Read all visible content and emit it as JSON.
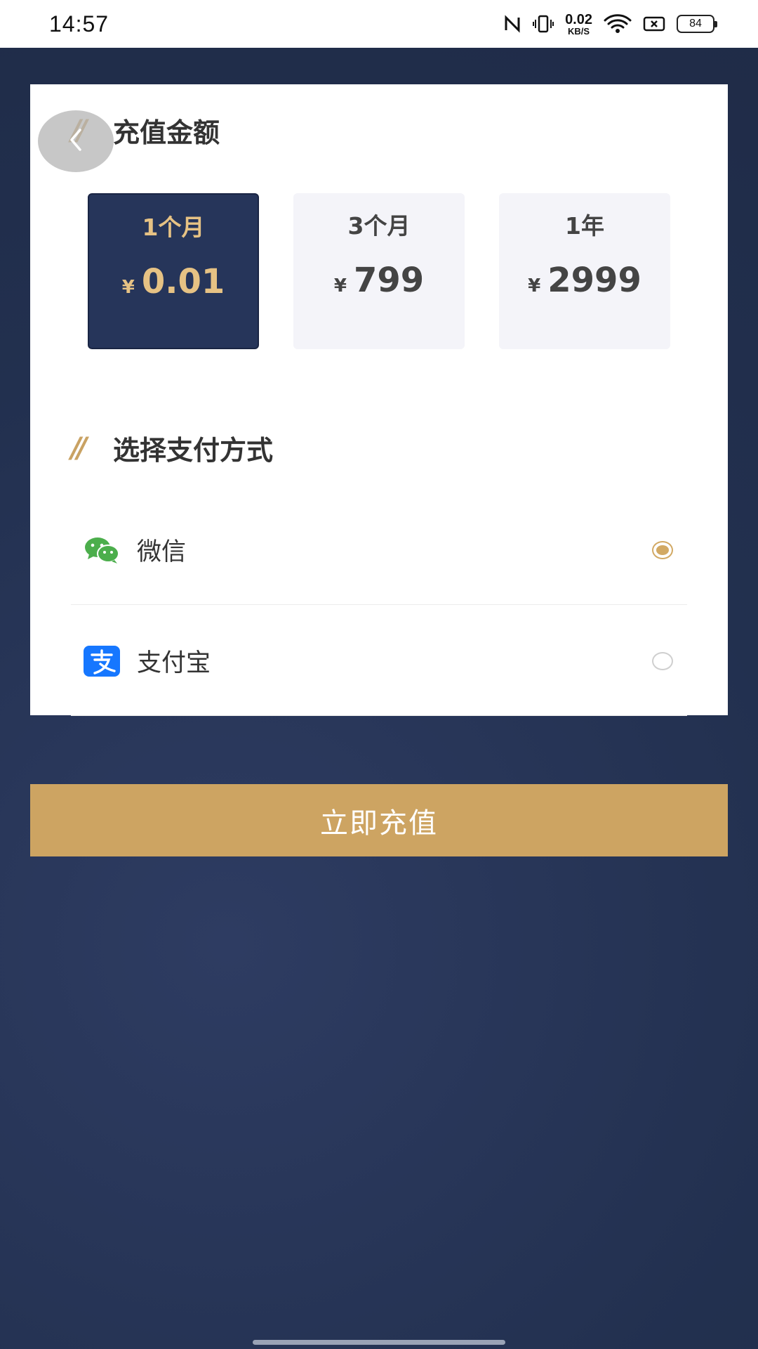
{
  "status_bar": {
    "time": "14:57",
    "net_speed_value": "0.02",
    "net_speed_unit": "KB/S",
    "battery_level": "84",
    "icons": [
      "nfc-icon",
      "vibrate-icon",
      "wifi-icon",
      "sim-error-icon",
      "battery-icon"
    ]
  },
  "recharge": {
    "title": "充值金额",
    "title_decoration": "//",
    "plans": [
      {
        "name": "1个月",
        "currency": "¥",
        "price": "0.01",
        "selected": true
      },
      {
        "name": "3个月",
        "currency": "¥",
        "price": "799",
        "selected": false
      },
      {
        "name": "1年",
        "currency": "¥",
        "price": "2999",
        "selected": false
      }
    ]
  },
  "payment": {
    "title": "选择支付方式",
    "title_decoration": "//",
    "methods": [
      {
        "label": "微信",
        "icon": "wechat-icon",
        "selected": true
      },
      {
        "label": "支付宝",
        "icon": "alipay-icon",
        "selected": false
      }
    ]
  },
  "actions": {
    "charge_label": "立即充值"
  },
  "colors": {
    "accent_gold": "#cda462",
    "navy": "#26355a",
    "selected_text": "#e6c284",
    "wechat_green": "#4cae4c",
    "alipay_blue": "#1677ff"
  }
}
